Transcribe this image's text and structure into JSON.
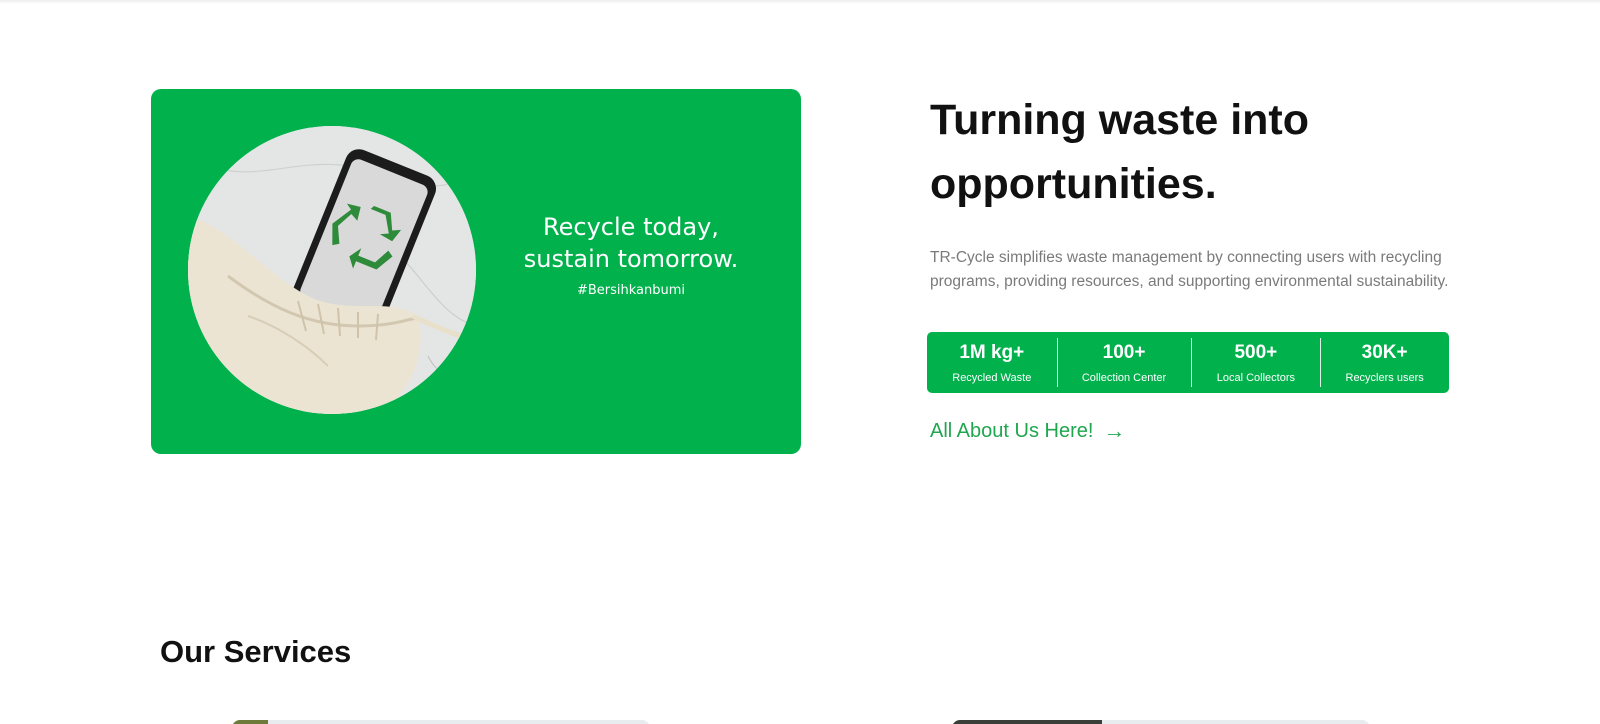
{
  "hero": {
    "tagline": "Recycle today, sustain tomorrow.",
    "hashtag": "#Bersihkanbumi",
    "image_icon": "recycle-icon",
    "accent_color": "#00b14c"
  },
  "about": {
    "title": "Turning waste into opportunities.",
    "description": "TR-Cycle simplifies waste management by connecting users with recycling programs, providing resources, and supporting environmental sustainability.",
    "stats": [
      {
        "value": "1M kg+",
        "label": "Recycled Waste"
      },
      {
        "value": "100+",
        "label": "Collection Center"
      },
      {
        "value": "500+",
        "label": "Local Collectors"
      },
      {
        "value": "30K+",
        "label": "Recyclers users"
      }
    ],
    "link_label": "All About Us Here!",
    "link_arrow": "→",
    "link_color": "#1fa64e"
  },
  "services": {
    "title": "Our Services"
  }
}
